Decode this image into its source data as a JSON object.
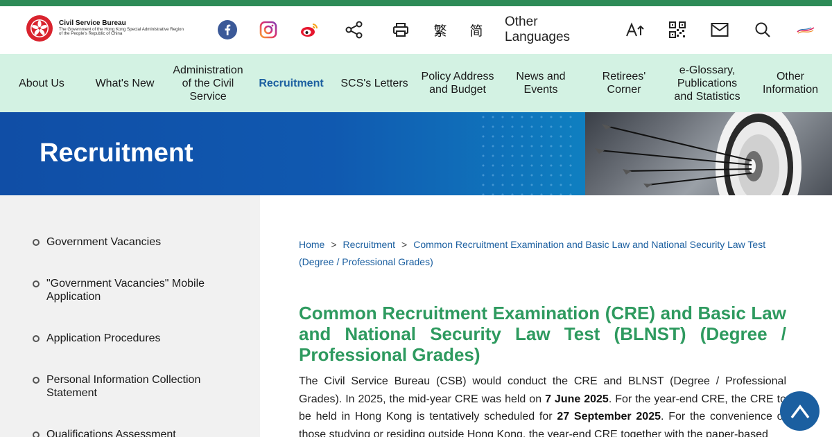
{
  "logo": {
    "title": "Civil Service Bureau",
    "subtitle_line1": "The Government of the Hong Kong Special Administrative Region",
    "subtitle_line2": "of the People's Republic of China"
  },
  "toolbar": {
    "traditional_chinese": "繁",
    "simplified_chinese": "简",
    "other_languages": "Other Languages"
  },
  "nav": {
    "items": [
      {
        "label": "About Us"
      },
      {
        "label": "What's New"
      },
      {
        "label": "Administration of the Civil Service"
      },
      {
        "label": "Recruitment"
      },
      {
        "label": "SCS's Letters"
      },
      {
        "label": "Policy Address and Budget"
      },
      {
        "label": "News and Events"
      },
      {
        "label": "Retirees' Corner"
      },
      {
        "label": "e-Glossary, Publications and Statistics"
      },
      {
        "label": "Other Information"
      }
    ],
    "active_color": "#1b5fa0",
    "background": "#d3f2e3"
  },
  "banner": {
    "title": "Recruitment"
  },
  "sidebar": {
    "items": [
      {
        "label": "Government Vacancies"
      },
      {
        "label": "\"Government Vacancies\" Mobile Application"
      },
      {
        "label": "Application Procedures"
      },
      {
        "label": "Personal Information Collection Statement"
      },
      {
        "label": "Qualifications Assessment"
      }
    ]
  },
  "breadcrumb": {
    "home": "Home",
    "separator": ">",
    "recruitment": "Recruitment",
    "current": "Common Recruitment Examination and Basic Law and National Security Law Test (Degree / Professional Grades)"
  },
  "main": {
    "title": "Common Recruitment Examination (CRE) and Basic Law and National Security Law Test (BLNST) (Degree / Professional Grades)",
    "para_part1": "The Civil Service Bureau (CSB) would conduct the CRE and BLNST (Degree / Professional Grades). In 2025, the mid-year CRE was held on ",
    "para_bold1": "7 June 2025",
    "para_part2": ". For the year-end CRE, the CRE to be held in Hong Kong is tentatively scheduled for ",
    "para_bold2": "27 September 2025",
    "para_part3": ". For the convenience of those studying or residing outside Hong Kong, the year-end CRE together with the paper-based"
  },
  "colors": {
    "top_bar": "#2e8b57",
    "title_green": "#2e9a5f",
    "link_blue": "#1b5fa0"
  }
}
